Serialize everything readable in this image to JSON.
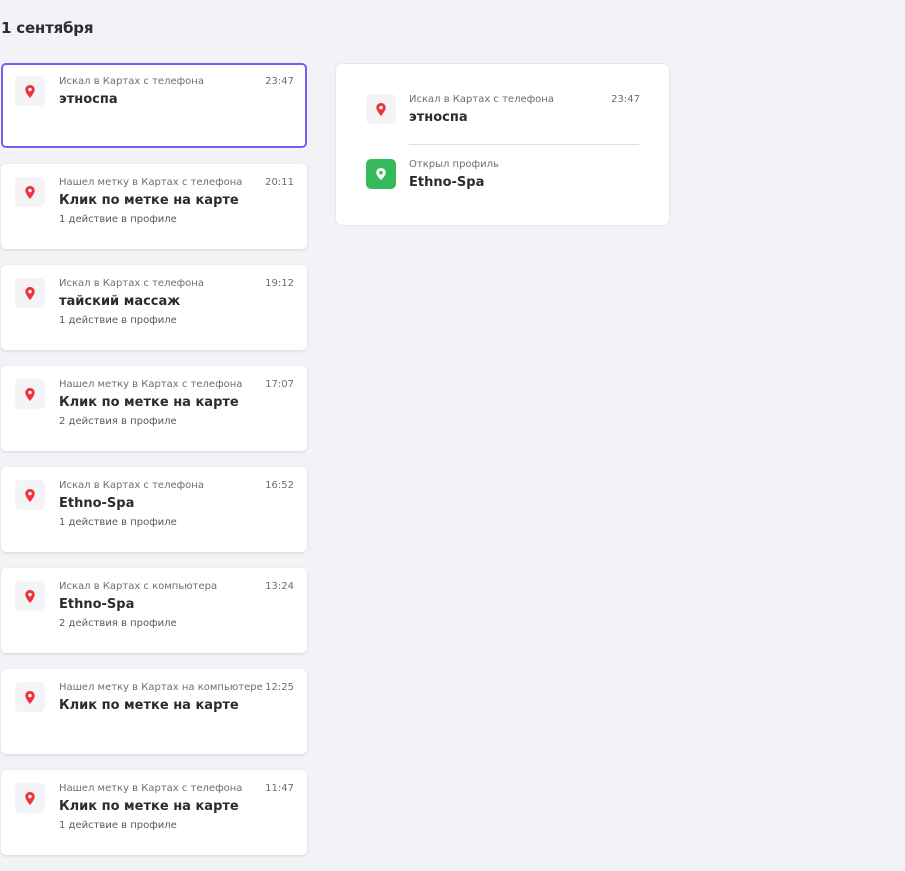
{
  "date_heading": "1 сентября",
  "events": [
    {
      "source": "Искал в Картах с телефона",
      "time": "23:47",
      "title": "этноспа",
      "subtitle": "",
      "selected": true,
      "icon": "map-pin-icon"
    },
    {
      "source": "Нашел метку в Картах с телефона",
      "time": "20:11",
      "title": "Клик по метке на карте",
      "subtitle": "1 действие в профиле",
      "icon": "map-pin-icon"
    },
    {
      "source": "Искал в Картах с телефона",
      "time": "19:12",
      "title": "тайский массаж",
      "subtitle": "1 действие в профиле",
      "icon": "map-pin-icon"
    },
    {
      "source": "Нашел метку в Картах с телефона",
      "time": "17:07",
      "title": "Клик по метке на карте",
      "subtitle": "2 действия в профиле",
      "icon": "map-pin-icon"
    },
    {
      "source": "Искал в Картах с телефона",
      "time": "16:52",
      "title": "Ethno-Spa",
      "subtitle": "1 действие в профиле",
      "icon": "map-pin-icon"
    },
    {
      "source": "Искал в Картах с компьютера",
      "time": "13:24",
      "title": "Ethno-Spa",
      "subtitle": "2 действия в профиле",
      "icon": "map-pin-icon"
    },
    {
      "source": "Нашел метку в Картах на компьютере",
      "time": "12:25",
      "title": "Клик по метке на карте",
      "subtitle": "",
      "icon": "map-pin-icon"
    },
    {
      "source": "Нашел метку в Картах с телефона",
      "time": "11:47",
      "title": "Клик по метке на карте",
      "subtitle": "1 действие в профиле",
      "icon": "map-pin-icon"
    }
  ],
  "detail": {
    "search": {
      "source": "Искал в Картах с телефона",
      "time": "23:47",
      "title": "этноспа",
      "icon": "map-pin-icon"
    },
    "profile": {
      "source": "Открыл профиль",
      "title": "Ethno-Spa",
      "icon": "profile-pin-icon"
    }
  },
  "colors": {
    "accent_selected": "#7a5cf0",
    "pin_red": "#f0323c",
    "profile_green": "#36b95a",
    "background": "#f2f3f7"
  }
}
